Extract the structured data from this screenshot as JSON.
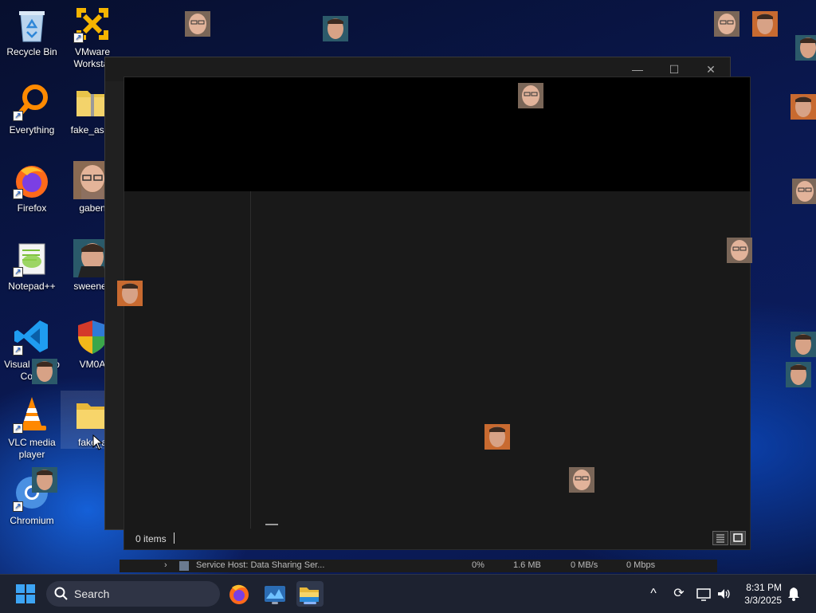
{
  "desktop": {
    "icons": [
      {
        "label": "Recycle Bin"
      },
      {
        "label": "VMware Workstat"
      },
      {
        "label": "Everything"
      },
      {
        "label": "fake_ass_"
      },
      {
        "label": "Firefox"
      },
      {
        "label": "gaben"
      },
      {
        "label": "Notepad++"
      },
      {
        "label": "sweeney"
      },
      {
        "label": "Visual Studio Code"
      },
      {
        "label": "VM0A"
      },
      {
        "label": "VLC media player"
      },
      {
        "label": "fake_a"
      },
      {
        "label": "Chromium"
      }
    ]
  },
  "back_window": {
    "controls": {
      "minimize": "—",
      "maximize": "☐",
      "close": "✕"
    }
  },
  "explorer": {
    "status": {
      "items_count": "0 items"
    }
  },
  "task_manager_row": {
    "name": "Service Host: Data Sharing Ser...",
    "cpu": "0%",
    "memory": "1.6 MB",
    "disk": "0 MB/s",
    "network": "0 Mbps"
  },
  "taskbar": {
    "search_label": "Search",
    "time": "8:31 PM",
    "date": "3/3/2025"
  },
  "colors": {
    "accent": "#1a6fd8",
    "taskbar": "#1d2230",
    "explorer_bg": "#191919"
  }
}
